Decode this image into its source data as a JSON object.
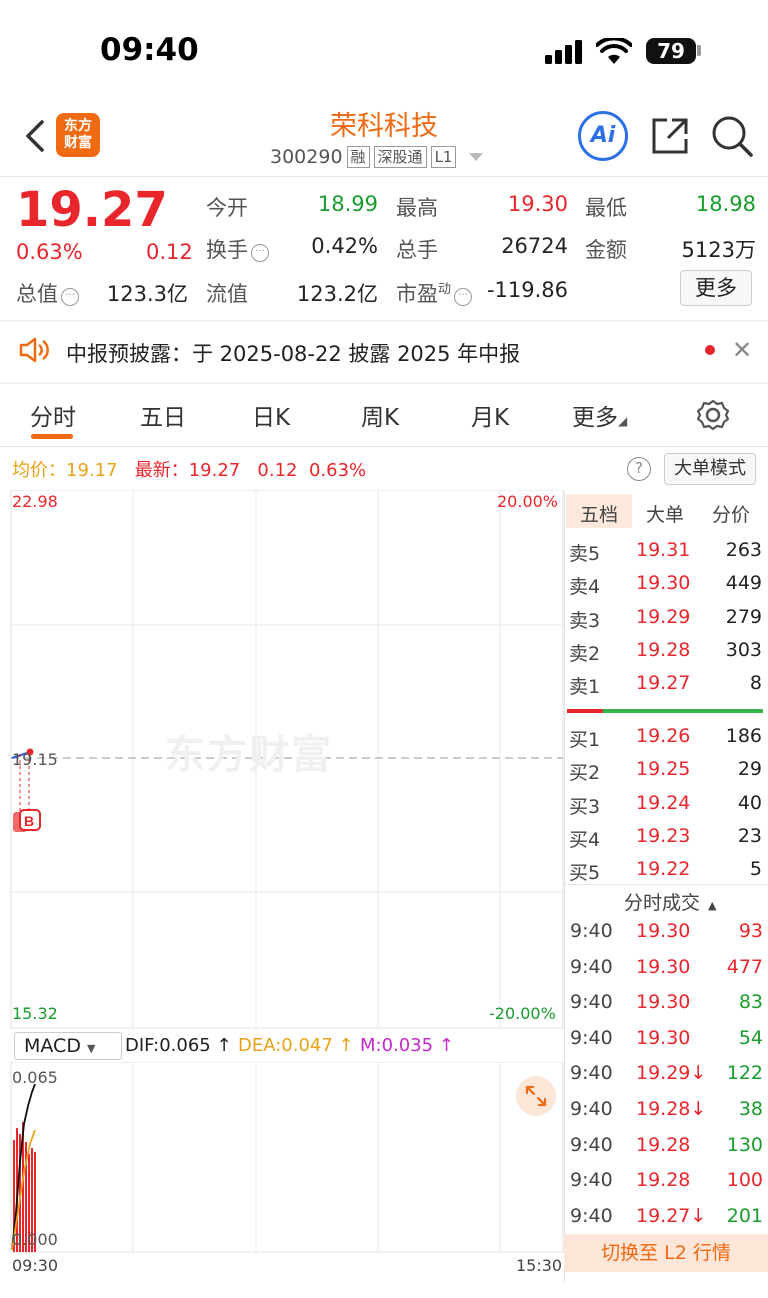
{
  "status_bar": {
    "time": "09:40",
    "battery": "79"
  },
  "header": {
    "logo_line1": "东方",
    "logo_line2": "财富",
    "title": "荣科科技",
    "code": "300290",
    "tags": [
      "融",
      "深股通",
      "L1"
    ],
    "ai_label": "Ai"
  },
  "quote": {
    "price": "19.27",
    "change_pct": "0.63%",
    "change": "0.12",
    "fields": {
      "open_label": "今开",
      "open": "18.99",
      "high_label": "最高",
      "high": "19.30",
      "low_label": "最低",
      "low": "18.98",
      "turnover_label": "换手",
      "turnover": "0.42%",
      "volume_label": "总手",
      "volume": "26724",
      "amount_label": "金额",
      "amount": "5123万",
      "mktcap_label": "总值",
      "mktcap": "123.3亿",
      "float_label": "流值",
      "float": "123.2亿",
      "pe_label": "市盈",
      "pe_sup": "动",
      "pe": "-119.86"
    },
    "more_label": "更多"
  },
  "notice": {
    "text": "中报预披露：于 2025-08-22 披露 2025 年中报"
  },
  "tabs": [
    "分时",
    "五日",
    "日K",
    "周K",
    "月K",
    "更多"
  ],
  "chart": {
    "avg_label": "均价：",
    "avg_value": "19.17",
    "latest_label": "最新：",
    "latest_value": "19.27",
    "latest_change": "0.12",
    "latest_pct": "0.63%",
    "bigorder_label": "大单模式",
    "help_icon": "question-circle-icon",
    "y_max": "22.98",
    "y_min": "15.32",
    "pct_max": "20.00%",
    "pct_min": "-20.00%",
    "prev_close": "19.15",
    "watermark": "东方财富",
    "marker": "B",
    "time_start": "09:30",
    "time_end": "15:30"
  },
  "macd": {
    "label": "MACD",
    "dif": "DIF:0.065 ↑",
    "dea": "DEA:0.047 ↑",
    "m": "M:0.035 ↑",
    "y_max": "0.065",
    "y_zero": "0.000"
  },
  "orderbook": {
    "tabs": [
      "五档",
      "大单",
      "分价"
    ],
    "asks": [
      {
        "label": "卖5",
        "price": "19.31",
        "vol": "263"
      },
      {
        "label": "卖4",
        "price": "19.30",
        "vol": "449"
      },
      {
        "label": "卖3",
        "price": "19.29",
        "vol": "279"
      },
      {
        "label": "卖2",
        "price": "19.28",
        "vol": "303"
      },
      {
        "label": "卖1",
        "price": "19.27",
        "vol": "8"
      }
    ],
    "bids": [
      {
        "label": "买1",
        "price": "19.26",
        "vol": "186"
      },
      {
        "label": "买2",
        "price": "19.25",
        "vol": "29"
      },
      {
        "label": "买3",
        "price": "19.24",
        "vol": "40"
      },
      {
        "label": "买4",
        "price": "19.23",
        "vol": "23"
      },
      {
        "label": "买5",
        "price": "19.22",
        "vol": "5"
      }
    ],
    "ratio_ask": 0.18,
    "trades_title": "分时成交",
    "trades": [
      {
        "time": "9:40",
        "price": "19.30",
        "vol": "93",
        "color": "red"
      },
      {
        "time": "9:40",
        "price": "19.30",
        "vol": "477",
        "color": "red"
      },
      {
        "time": "9:40",
        "price": "19.30",
        "vol": "83",
        "color": "green"
      },
      {
        "time": "9:40",
        "price": "19.30",
        "vol": "54",
        "color": "green"
      },
      {
        "time": "9:40",
        "price": "19.29↓",
        "vol": "122",
        "color": "green"
      },
      {
        "time": "9:40",
        "price": "19.28↓",
        "vol": "38",
        "color": "green"
      },
      {
        "time": "9:40",
        "price": "19.28",
        "vol": "130",
        "color": "green"
      },
      {
        "time": "9:40",
        "price": "19.28",
        "vol": "100",
        "color": "red"
      },
      {
        "time": "9:40",
        "price": "19.27↓",
        "vol": "201",
        "color": "green"
      }
    ],
    "l2_label": "切换至 L2 行情"
  }
}
